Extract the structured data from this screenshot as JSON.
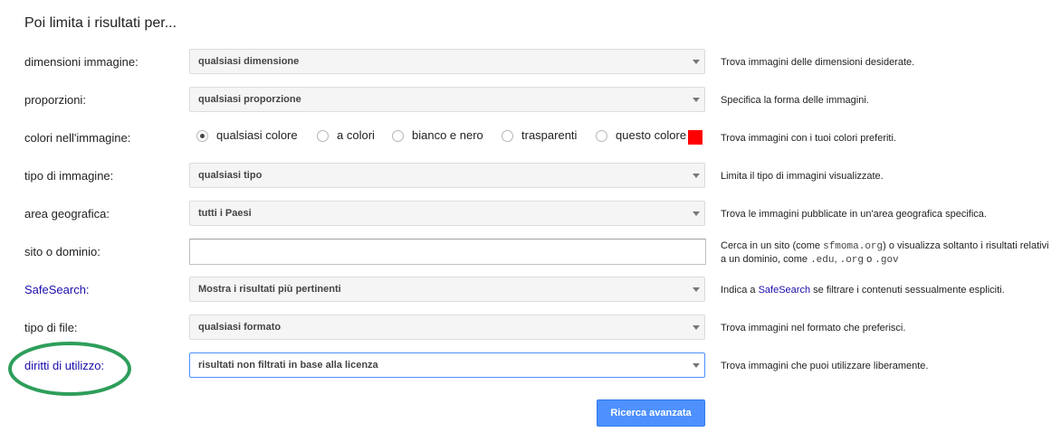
{
  "heading": "Poi limita i risultati per...",
  "rows": {
    "size": {
      "label": "dimensioni immagine:",
      "value": "qualsiasi dimensione",
      "hint": "Trova immagini delle dimensioni desiderate."
    },
    "aspect": {
      "label": "proporzioni:",
      "value": "qualsiasi proporzione",
      "hint": "Specifica la forma delle immagini."
    },
    "colors": {
      "label": "colori nell'immagine:",
      "options": [
        "qualsiasi colore",
        "a colori",
        "bianco e nero",
        "trasparenti",
        "questo colore"
      ],
      "selected": "qualsiasi colore",
      "swatch_color": "#ff0000",
      "hint": "Trova immagini con i tuoi colori preferiti."
    },
    "type": {
      "label": "tipo di immagine:",
      "value": "qualsiasi tipo",
      "hint": "Limita il tipo di immagini visualizzate."
    },
    "region": {
      "label": "area geografica:",
      "value": "tutti i Paesi",
      "hint": "Trova le immagini pubblicate in un'area geografica specifica."
    },
    "site": {
      "label": "sito o dominio:",
      "value": "",
      "hint_line1_a": "Cerca in un sito (come",
      "hint_line1_code": "sfmoma.org",
      "hint_line1_b": ") o visualizza soltanto i risultati relativi",
      "hint_line2_a": "a un dominio, come",
      "hint_line2_code1": ".edu",
      "hint_line2_sep": ",",
      "hint_line2_code2": ".org",
      "hint_line2_or": "o",
      "hint_line2_code3": ".gov"
    },
    "safesearch": {
      "label": "SafeSearch:",
      "value": "Mostra i risultati più pertinenti",
      "hint_a": "Indica a",
      "hint_link": "SafeSearch",
      "hint_b": "se filtrare i contenuti sessualmente espliciti."
    },
    "filetype": {
      "label": "tipo di file:",
      "value": "qualsiasi formato",
      "hint": "Trova immagini nel formato che preferisci."
    },
    "rights": {
      "label": "diritti di utilizzo:",
      "value": "risultati non filtrati in base alla licenza",
      "hint": "Trova immagini che puoi utilizzare liberamente."
    }
  },
  "submit_label": "Ricerca avanzata",
  "colors": {
    "link": "#1a0dab",
    "button": "#4d90fe",
    "highlight": "#2e9e5b"
  }
}
